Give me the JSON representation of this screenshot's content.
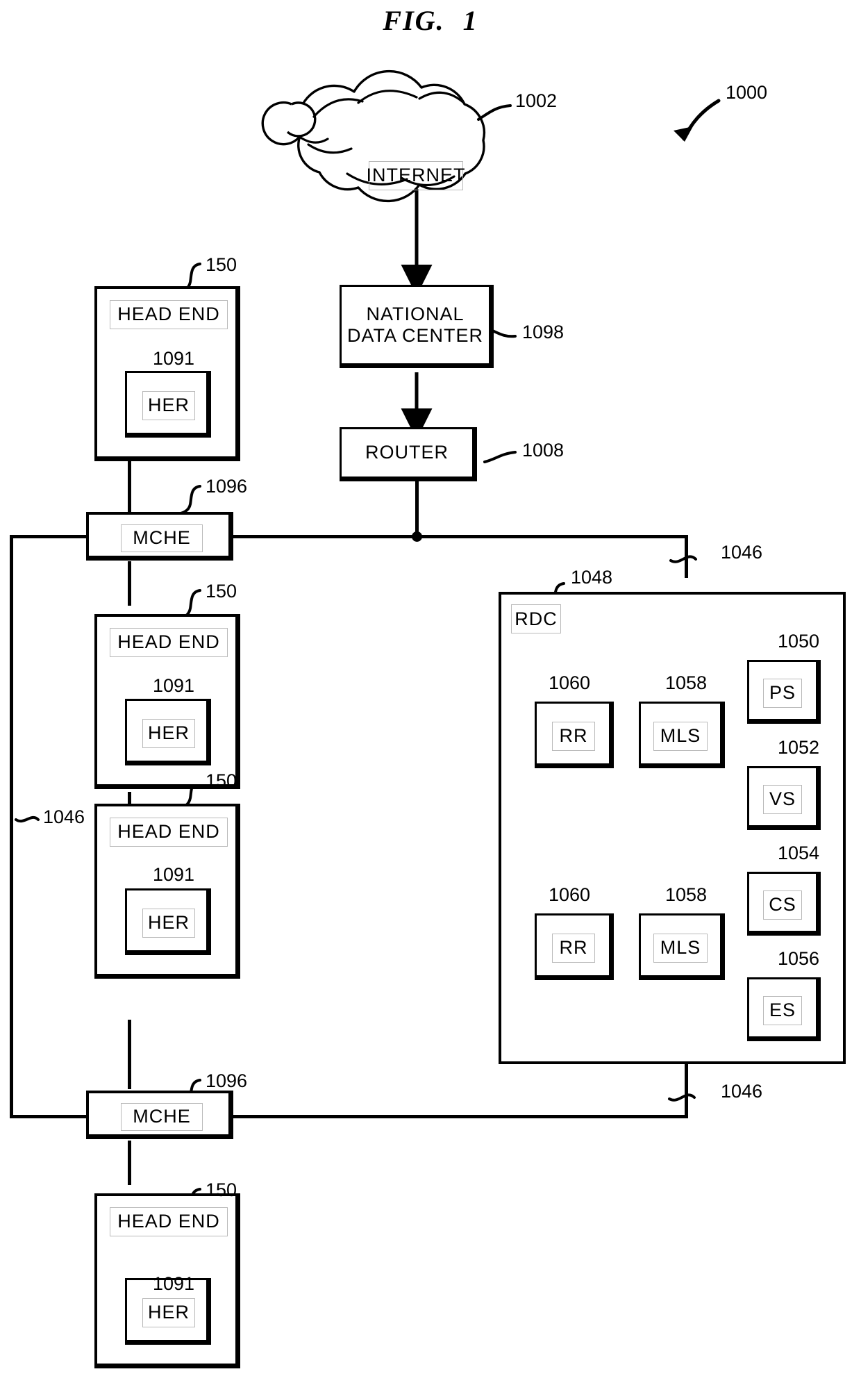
{
  "figure": {
    "title_prefix": "FIG.",
    "title_number": "1",
    "system_ref": "1000"
  },
  "nodes": {
    "internet": {
      "label": "INTERNET",
      "ref": "1002"
    },
    "national_data_center": {
      "label_line1": "NATIONAL",
      "label_line2": "DATA CENTER",
      "ref": "1098"
    },
    "router": {
      "label": "ROUTER",
      "ref": "1008"
    },
    "mche_top": {
      "label": "MCHE",
      "ref": "1096"
    },
    "mche_bottom": {
      "label": "MCHE",
      "ref": "1096"
    },
    "rdc": {
      "label": "RDC",
      "ref": "1048",
      "outer_ref": "1046"
    }
  },
  "head_ends": [
    {
      "label": "HEAD END",
      "ref": "150",
      "inner_label": "HER",
      "inner_ref": "1091"
    },
    {
      "label": "HEAD END",
      "ref": "150",
      "inner_label": "HER",
      "inner_ref": "1091"
    },
    {
      "label": "HEAD END",
      "ref": "150",
      "inner_label": "HER",
      "inner_ref": "1091"
    },
    {
      "label": "HEAD END",
      "ref": "150",
      "inner_label": "HER",
      "inner_ref": "1091"
    }
  ],
  "rdc_components": {
    "row1": [
      {
        "label": "RR",
        "ref": "1060"
      },
      {
        "label": "MLS",
        "ref": "1058"
      }
    ],
    "row2": [
      {
        "label": "RR",
        "ref": "1060"
      },
      {
        "label": "MLS",
        "ref": "1058"
      }
    ],
    "column": [
      {
        "label": "PS",
        "ref": "1050"
      },
      {
        "label": "VS",
        "ref": "1052"
      },
      {
        "label": "CS",
        "ref": "1054"
      },
      {
        "label": "ES",
        "ref": "1056"
      }
    ]
  },
  "network_refs": {
    "left_bus": "1046",
    "right_bus_top": "1046",
    "right_bus_bottom": "1046"
  },
  "colors": {
    "ink": "#000000",
    "paper": "#ffffff"
  }
}
